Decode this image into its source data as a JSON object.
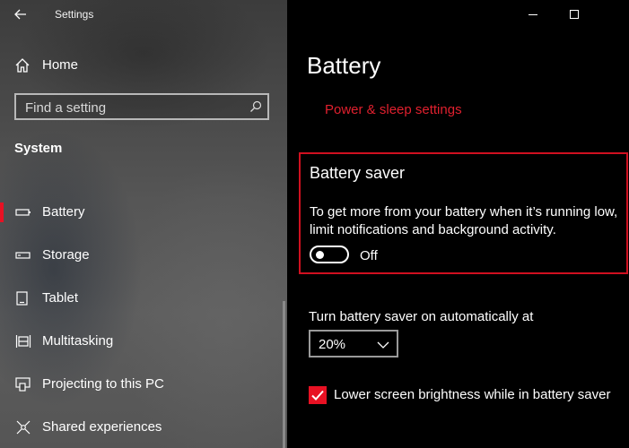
{
  "window": {
    "title": "Settings"
  },
  "sidebar": {
    "home_label": "Home",
    "search": {
      "placeholder": "Find a setting",
      "value": ""
    },
    "section_title": "System",
    "items": [
      {
        "label": "Battery",
        "icon": "battery-icon",
        "selected": true
      },
      {
        "label": "Storage",
        "icon": "storage-icon",
        "selected": false
      },
      {
        "label": "Tablet",
        "icon": "tablet-icon",
        "selected": false
      },
      {
        "label": "Multitasking",
        "icon": "multitasking-icon",
        "selected": false
      },
      {
        "label": "Projecting to this PC",
        "icon": "projecting-icon",
        "selected": false
      },
      {
        "label": "Shared experiences",
        "icon": "shared-experiences-icon",
        "selected": false
      }
    ]
  },
  "main": {
    "title": "Battery",
    "power_link": "Power & sleep settings",
    "battery_saver": {
      "title": "Battery saver",
      "description": "To get more from your battery when it’s running low, limit notifications and background activity.",
      "toggle_state": "Off"
    },
    "auto_label": "Turn battery saver on automatically at",
    "auto_value": "20%",
    "brightness_label": "Lower screen brightness while in battery saver",
    "brightness_checked": true
  },
  "colors": {
    "accent": "#e81123",
    "link": "#e0202e",
    "highlight_border": "#d01020",
    "background": "#000000"
  }
}
